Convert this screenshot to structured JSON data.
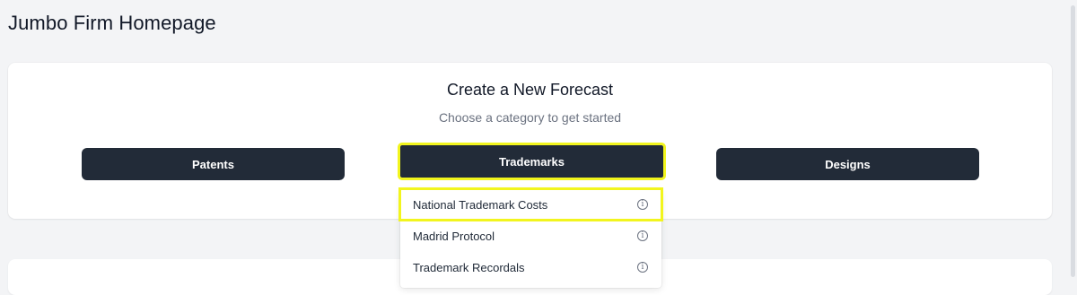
{
  "page": {
    "title": "Jumbo Firm Homepage"
  },
  "forecast": {
    "title": "Create a New Forecast",
    "subtitle": "Choose a category to get started",
    "categories": [
      {
        "label": "Patents"
      },
      {
        "label": "Trademarks"
      },
      {
        "label": "Designs"
      }
    ]
  },
  "trademarks_menu": {
    "items": [
      {
        "label": "National Trademark Costs",
        "icon": "info-icon"
      },
      {
        "label": "Madrid Protocol",
        "icon": "info-icon"
      },
      {
        "label": "Trademark Recordals",
        "icon": "info-icon"
      }
    ]
  },
  "colors": {
    "button_bg": "#222b38",
    "highlight": "#f2f51e",
    "page_bg": "#f3f4f6"
  }
}
